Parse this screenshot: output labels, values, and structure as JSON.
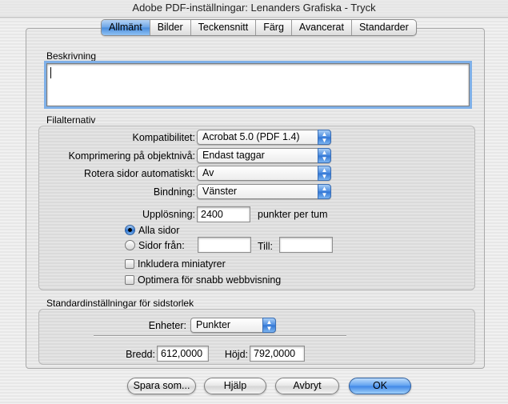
{
  "window": {
    "title": "Adobe PDF-inställningar: Lenanders Grafiska - Tryck"
  },
  "tabs": [
    "Allmänt",
    "Bilder",
    "Teckensnitt",
    "Färg",
    "Avancerat",
    "Standarder"
  ],
  "active_tab": "Allmänt",
  "description": {
    "label": "Beskrivning",
    "value": ""
  },
  "file_options": {
    "label": "Filalternativ",
    "compatibility": {
      "label": "Kompatibilitet:",
      "value": "Acrobat 5.0 (PDF 1.4)"
    },
    "object_compression": {
      "label": "Komprimering på objektnivå:",
      "value": "Endast taggar"
    },
    "auto_rotate": {
      "label": "Rotera sidor automatiskt:",
      "value": "Av"
    },
    "binding": {
      "label": "Bindning:",
      "value": "Vänster"
    },
    "resolution": {
      "label": "Upplösning:",
      "value": "2400",
      "unit": "punkter per tum"
    },
    "all_pages": {
      "label": "Alla sidor",
      "selected": true
    },
    "pages_from": {
      "label": "Sidor från:",
      "from_value": "",
      "to_label": "Till:",
      "to_value": "",
      "selected": false
    },
    "embed_thumbnails": {
      "label": "Inkludera miniatyrer",
      "checked": false
    },
    "optimize_web": {
      "label": "Optimera för snabb webbvisning",
      "checked": false
    }
  },
  "page_size": {
    "label": "Standardinställningar för sidstorlek",
    "units": {
      "label": "Enheter:",
      "value": "Punkter"
    },
    "width": {
      "label": "Bredd:",
      "value": "612,0000"
    },
    "height": {
      "label": "Höjd:",
      "value": "792,0000"
    }
  },
  "buttons": {
    "save_as": "Spara som...",
    "help": "Hjälp",
    "cancel": "Avbryt",
    "ok": "OK"
  },
  "colors": {
    "accent": "#4a8ddc",
    "desktop": "#8fb2da"
  }
}
